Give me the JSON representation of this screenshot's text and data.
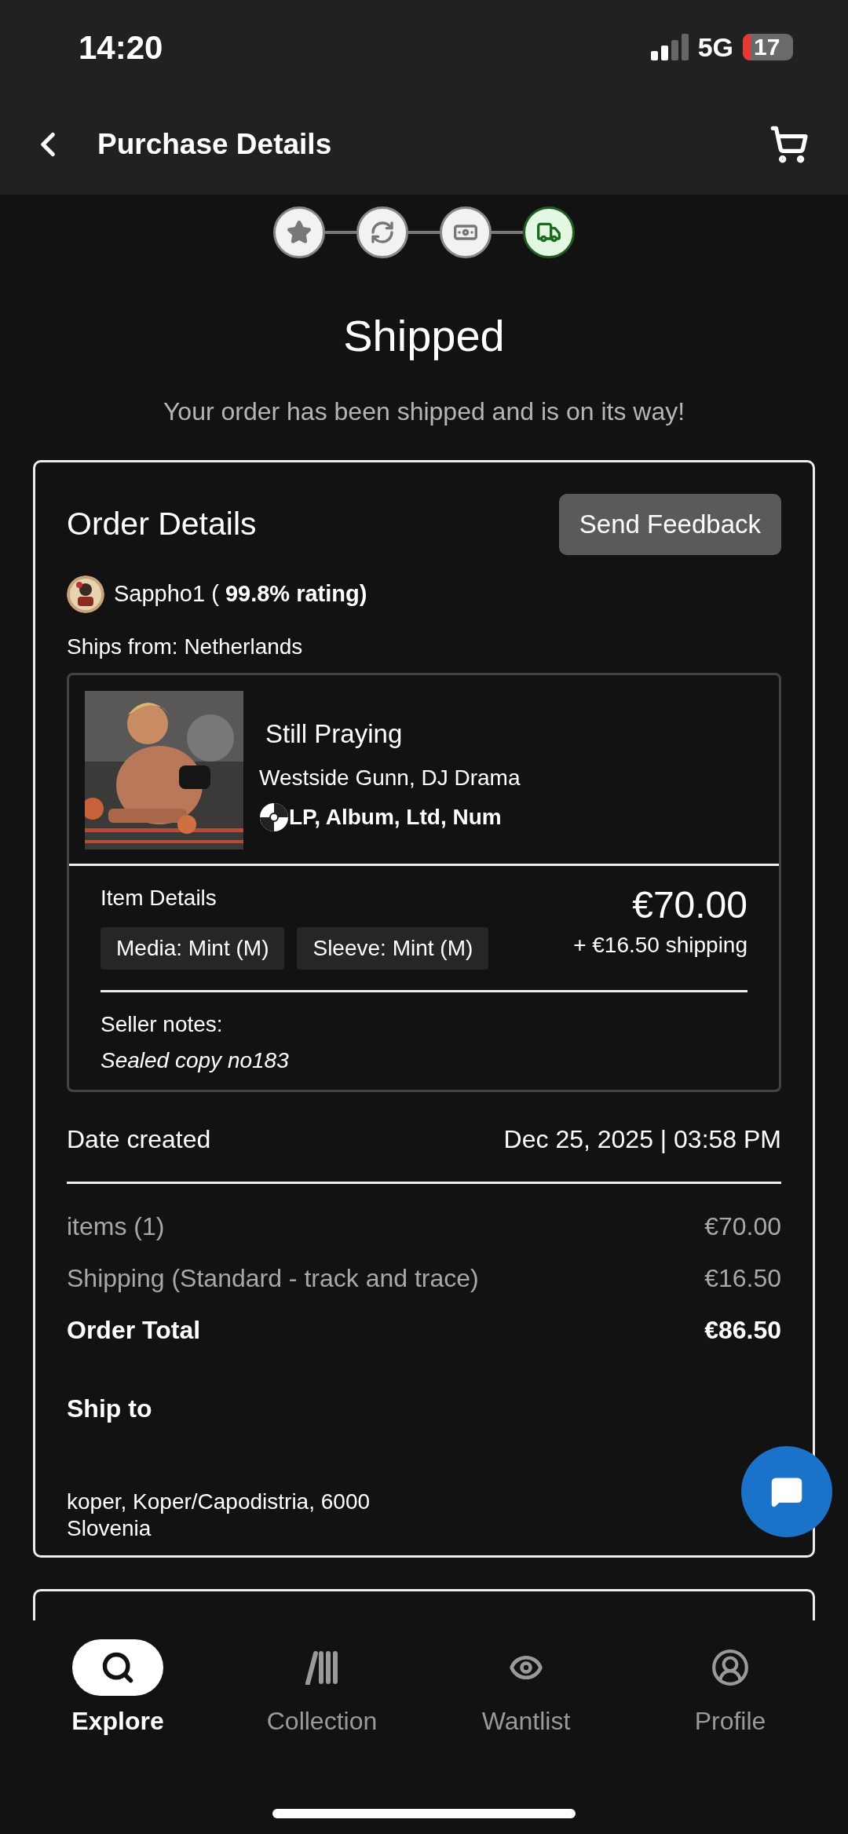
{
  "status_bar": {
    "time": "14:20",
    "network": "5G",
    "battery": "17"
  },
  "header": {
    "title": "Purchase Details"
  },
  "steps": [
    {
      "kind": "star",
      "active": false
    },
    {
      "kind": "sync",
      "active": false
    },
    {
      "kind": "money",
      "active": false
    },
    {
      "kind": "truck",
      "active": true
    }
  ],
  "status": {
    "title": "Shipped",
    "message": "Your order has been shipped and is on its way!"
  },
  "order": {
    "title": "Order Details",
    "feedback_button": "Send Feedback",
    "seller": "Sappho1 ( **99.8% rating)**",
    "ships_from": "Ships from: Netherlands",
    "item": {
      "title": "Still Praying",
      "artist": "Westside Gunn, DJ Drama",
      "format": "LP, Album, Ltd, Num",
      "details_label": "Item Details",
      "price": "€70.00",
      "shipping": "+ €16.50 shipping",
      "conditions": [
        "Media: Mint (M)",
        "Sleeve: Mint (M)"
      ],
      "notes_label": "Seller notes:",
      "notes": "Sealed copy no183"
    },
    "date_label": "Date created",
    "date": "Dec 25, 2025 | 03:58 PM",
    "lines": [
      {
        "label": "items (1)",
        "amount": "€70.00",
        "kind": "line"
      },
      {
        "label": "Shipping (Standard - track and trace)",
        "amount": "€16.50",
        "kind": "line"
      },
      {
        "label": "Order Total",
        "amount": "€86.50",
        "kind": "total"
      }
    ],
    "ship_to": {
      "title": "Ship to",
      "lines": [
        "koper, Koper/Capodistria, 6000",
        "Slovenia"
      ]
    }
  },
  "nav": [
    {
      "label": "Explore",
      "kind": "search",
      "selected": true
    },
    {
      "label": "Collection",
      "kind": "collection",
      "selected": false
    },
    {
      "label": "Wantlist",
      "kind": "eye",
      "selected": false
    },
    {
      "label": "Profile",
      "kind": "profile",
      "selected": false
    }
  ]
}
